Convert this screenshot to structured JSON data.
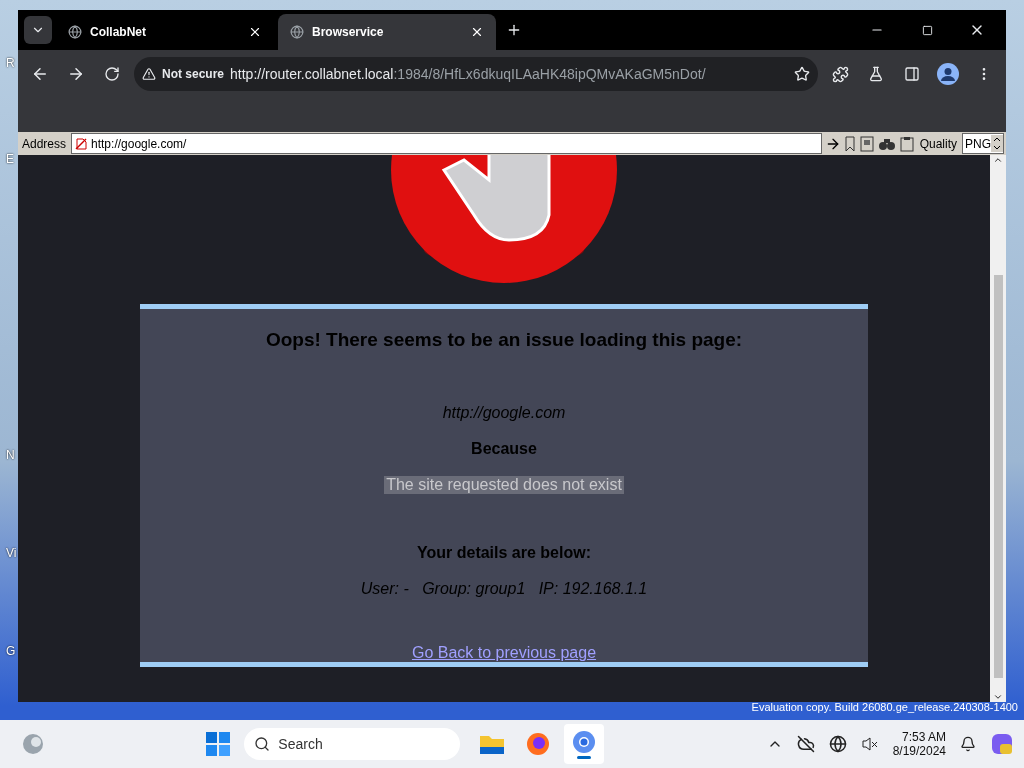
{
  "desktop": {
    "icon_labels": [
      "R",
      "E",
      "N",
      "Vi",
      "G"
    ],
    "watermark": "Evaluation copy. Build 26080.ge_release.240308-1400"
  },
  "browser": {
    "tabs": [
      {
        "title": "CollabNet",
        "selected": false
      },
      {
        "title": "Browservice",
        "selected": true
      }
    ],
    "security": "Not secure",
    "url_host": "http://router.collabnet.local",
    "url_path": ":1984/8/HfLx6dkuqILAaHK48ipQMvAKaGM5nDot/"
  },
  "service_bar": {
    "address_label": "Address",
    "address": "http://google.com/",
    "quality_label": "Quality",
    "quality": "PNG"
  },
  "error": {
    "title": "Oops! There seems to be an issue loading this page:",
    "url": "http://google.com",
    "because": "Because",
    "reason": "The site requested does not exist",
    "details_title": "Your details are below:",
    "details": "User: -   Group: group1   IP: 192.168.1.1",
    "back_link": "Go Back to previous page"
  },
  "taskbar": {
    "search": "Search",
    "apps": [
      {
        "kind": "files",
        "selected": false
      },
      {
        "kind": "firefox",
        "selected": false
      },
      {
        "kind": "chrome",
        "selected": true
      }
    ],
    "time": "7:53 AM",
    "date": "8/19/2024"
  }
}
